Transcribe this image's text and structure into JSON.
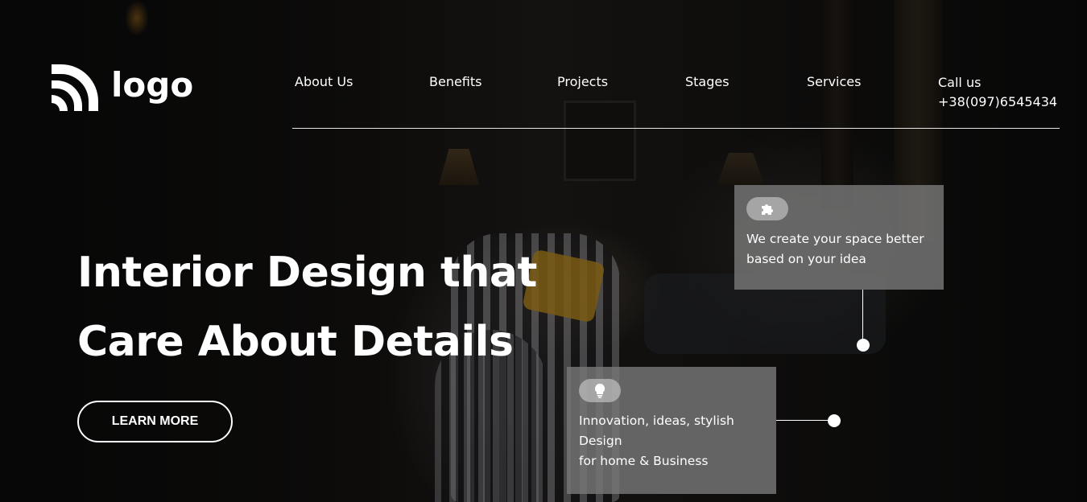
{
  "logo": {
    "text": "logo",
    "icon": "wifi-arcs-logo-icon"
  },
  "nav": {
    "items": [
      {
        "label": "About Us"
      },
      {
        "label": "Benefits"
      },
      {
        "label": "Projects"
      },
      {
        "label": "Stages"
      },
      {
        "label": "Services"
      }
    ],
    "call_label": "Call us",
    "phone": "+38(097)6545434"
  },
  "hero": {
    "headline_line1": "Interior Design that",
    "headline_line2": "Care About Details",
    "button_label": "LEARN MORE"
  },
  "cards": [
    {
      "icon": "puzzle-icon",
      "line1": "We create your space better",
      "line2": "based on your idea"
    },
    {
      "icon": "lightbulb-icon",
      "line1": "Innovation, ideas, stylish",
      "line2": "Design",
      "line3": "for home & Business"
    }
  ]
}
